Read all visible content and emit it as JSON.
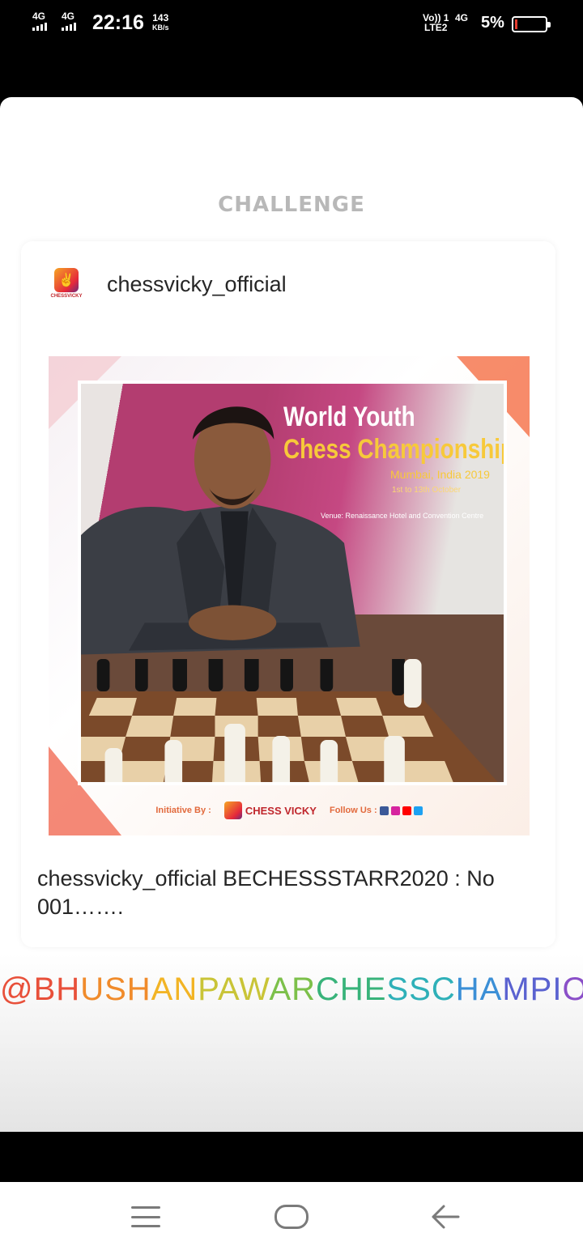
{
  "status_bar": {
    "net1": "4G",
    "net2": "4G",
    "time": "22:16",
    "speed_value": "143",
    "speed_unit": "KB/s",
    "volte_top": "Vo)) 1",
    "volte_bottom": "LTE2",
    "net3": "4G",
    "battery_pct": "5%",
    "battery_level": 0.05,
    "battery_low_color": "#e23b2e"
  },
  "story": {
    "title": "CHALLENGE",
    "mention": "@BHUSHANPAWARCHESSCHAMPION",
    "mention_colors": [
      "#e8503a",
      "#f08b2b",
      "#f2b425",
      "#c9c437",
      "#7cc04a",
      "#38b37a",
      "#2fb0b8",
      "#3b8fd6",
      "#5a62d0",
      "#8a4fc8"
    ]
  },
  "post": {
    "avatar_brand": "CHESSVICKY",
    "username": "chessvicky_official",
    "caption_user": "chessvicky_official",
    "caption_text": "BECHESSSTARR2020 : No 001……."
  },
  "photo": {
    "banner_line1": "World Youth",
    "banner_line2": "Chess Championship",
    "banner_line3": "Mumbai, India 2019",
    "banner_line4": "1st to 13th October",
    "banner_line5": "Venue: Renaissance Hotel and Convention Centre",
    "initiative_label": "Initiative By :",
    "brand": "CHESS VICKY",
    "follow_label": "Follow Us :",
    "follow_icons": [
      "facebook-icon",
      "instagram-icon",
      "youtube-icon",
      "twitter-icon"
    ],
    "follow_colors": [
      "#3b5998",
      "#d6249f",
      "#ff0000",
      "#1da1f2"
    ]
  },
  "nav_bar": {
    "buttons": [
      "menu",
      "home",
      "back"
    ]
  }
}
